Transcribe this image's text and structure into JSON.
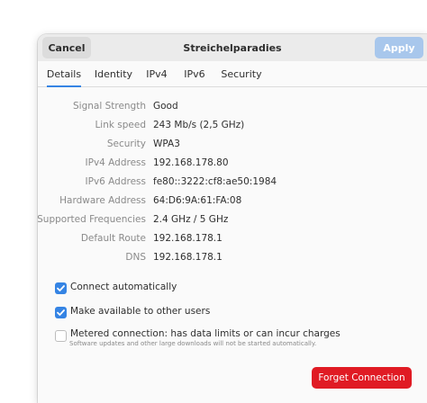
{
  "header": {
    "cancel_label": "Cancel",
    "title": "Streichelparadies",
    "apply_label": "Apply"
  },
  "tabs": [
    {
      "label": "Details",
      "active": true
    },
    {
      "label": "Identity",
      "active": false
    },
    {
      "label": "IPv4",
      "active": false
    },
    {
      "label": "IPv6",
      "active": false
    },
    {
      "label": "Security",
      "active": false
    }
  ],
  "details": [
    {
      "label": "Signal Strength",
      "value": "Good"
    },
    {
      "label": "Link speed",
      "value": "243 Mb/s (2,5 GHz)"
    },
    {
      "label": "Security",
      "value": "WPA3"
    },
    {
      "label": "IPv4 Address",
      "value": "192.168.178.80"
    },
    {
      "label": "IPv6 Address",
      "value": "fe80::3222:cf8:ae50:1984"
    },
    {
      "label": "Hardware Address",
      "value": "64:D6:9A:61:FA:08"
    },
    {
      "label": "Supported Frequencies",
      "value": "2.4 GHz / 5 GHz"
    },
    {
      "label": "Default Route",
      "value": "192.168.178.1"
    },
    {
      "label": "DNS",
      "value": "192.168.178.1"
    }
  ],
  "options": {
    "connect_auto": {
      "label": "Connect automatically",
      "checked": true
    },
    "available_others": {
      "label": "Make available to other users",
      "checked": true
    },
    "metered": {
      "label": "Metered connection: has data limits or can incur charges",
      "sublabel": "Software updates and other large downloads will not be started automatically.",
      "checked": false
    }
  },
  "forget_label": "Forget Connection",
  "colors": {
    "accent": "#3584e4",
    "destructive": "#e01b24",
    "apply_disabled": "#a8c7ec"
  }
}
